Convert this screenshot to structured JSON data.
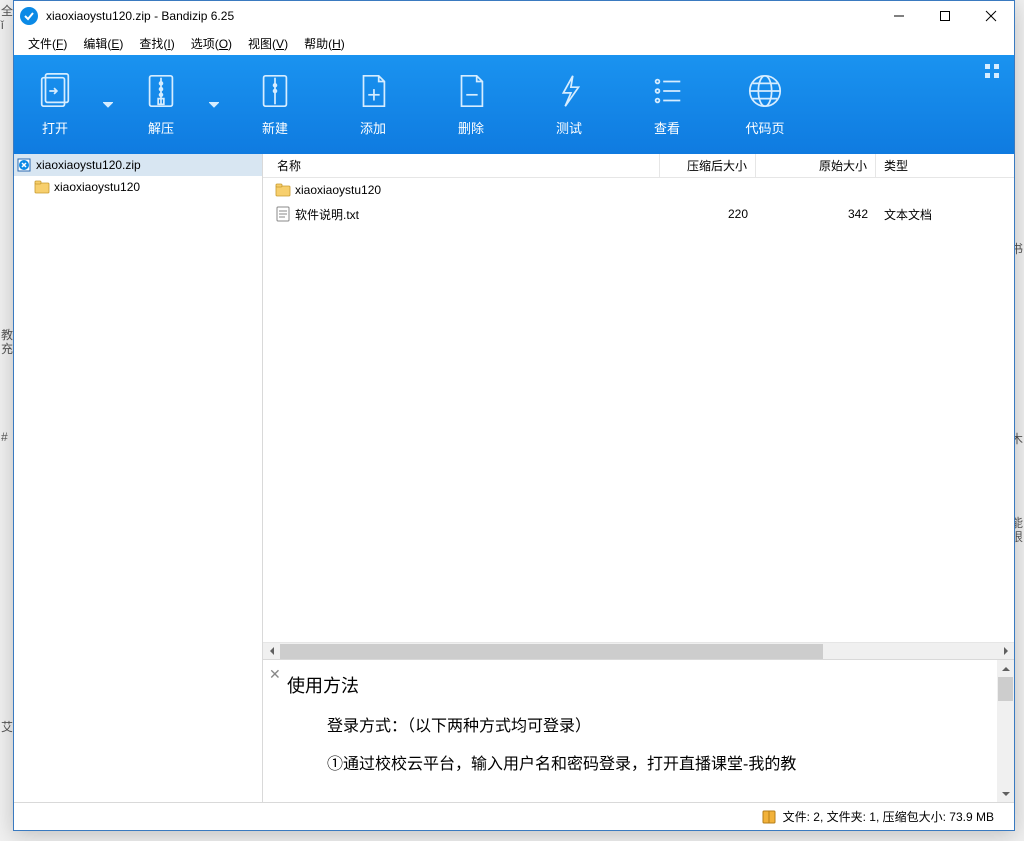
{
  "window_title": "xiaoxiaoystu120.zip - Bandizip 6.25",
  "menu": {
    "file": "文件(",
    "file_u": "F",
    "file_end": ")",
    "edit": "编辑(",
    "edit_u": "E",
    "edit_end": ")",
    "find": "查找(",
    "find_u": "I",
    "find_end": ")",
    "options": "选项(",
    "options_u": "O",
    "options_end": ")",
    "view": "视图(",
    "view_u": "V",
    "view_end": ")",
    "help": "帮助(",
    "help_u": "H",
    "help_end": ")"
  },
  "toolbar": {
    "open": "打开",
    "extract": "解压",
    "new": "新建",
    "add": "添加",
    "delete": "删除",
    "test": "测试",
    "view": "查看",
    "codepage": "代码页"
  },
  "tree": {
    "root": "xiaoxiaoystu120.zip",
    "child": "xiaoxiaoystu120"
  },
  "columns": {
    "name": "名称",
    "compressed": "压缩后大小",
    "original": "原始大小",
    "type": "类型"
  },
  "files": [
    {
      "name": "xiaoxiaoystu120",
      "compressed": "",
      "original": "",
      "type": "",
      "kind": "folder"
    },
    {
      "name": "软件说明.txt",
      "compressed": "220",
      "original": "342",
      "type": "文本文档",
      "kind": "txt"
    }
  ],
  "preview": {
    "title": "使用方法",
    "line1": "登录方式：（以下两种方式均可登录）",
    "line2": "①通过校校云平台，输入用户名和密码登录，打开直播课堂-我的教"
  },
  "status": "文件: 2, 文件夹: 1, 压缩包大小: 73.9 MB",
  "desk_hints": {
    "left1": "教充",
    "left3": "艾",
    "right2": "能很"
  }
}
